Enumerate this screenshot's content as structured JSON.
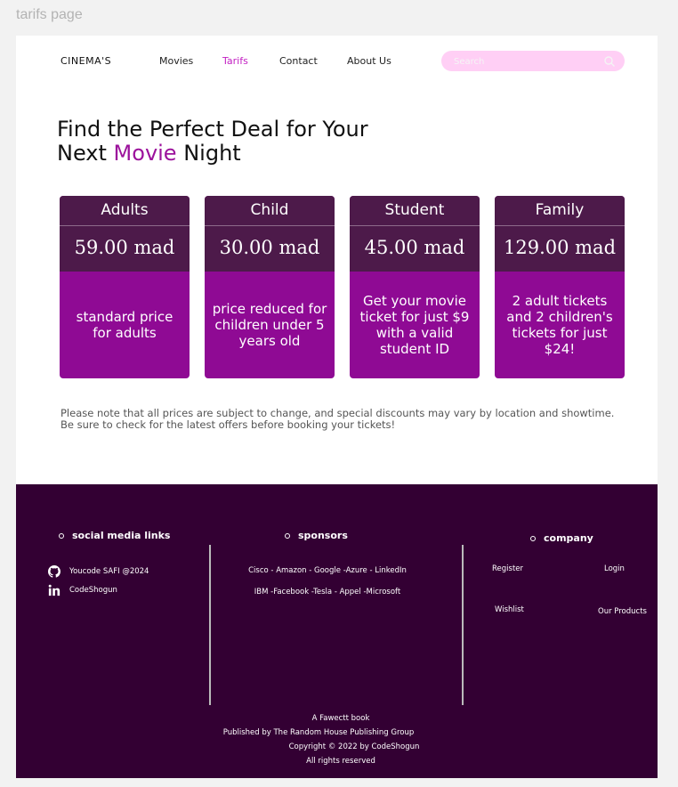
{
  "frame_label": "tarifs page",
  "nav": {
    "brand": "CINEMA'S",
    "links": [
      {
        "label": "Movies",
        "active": false
      },
      {
        "label": "Tarifs",
        "active": true
      },
      {
        "label": "Contact",
        "active": false
      },
      {
        "label": "About Us",
        "active": false
      }
    ],
    "search_placeholder": "Search"
  },
  "hero": {
    "line1": "Find the Perfect Deal for Your",
    "line2_before": "Next ",
    "line2_accent": "Movie",
    "line2_after": " Night"
  },
  "pricing_cards": [
    {
      "title": "Adults",
      "price": "59.00 mad",
      "description": "standard price for adults"
    },
    {
      "title": "Child",
      "price": "30.00 mad",
      "description": "price reduced for children under 5 years old"
    },
    {
      "title": "Student",
      "price": "45.00 mad",
      "description": "Get your movie ticket for just $9 with a valid student ID"
    },
    {
      "title": "Family",
      "price": "129.00 mad",
      "description": "2 adult tickets and 2 children's tickets for just $24!"
    }
  ],
  "note": "Please note that all prices are subject to change, and special discounts may vary by location and showtime. Be sure to check for the latest offers before booking your tickets!",
  "footer": {
    "social": {
      "heading": "social media links",
      "items": [
        {
          "icon": "github-icon",
          "label": "Youcode SAFI @2024"
        },
        {
          "icon": "linkedin-icon",
          "label": "CodeShogun"
        }
      ]
    },
    "sponsors": {
      "heading": "sponsors",
      "lines": [
        "Cisco - Amazon - Google -Azure - LinkedIn",
        "IBM -Facebook -Tesla - Appel -Microsoft"
      ]
    },
    "company": {
      "heading": "company",
      "links": [
        "Register",
        "Login",
        "Wishlist",
        "Our Products"
      ]
    },
    "credits": [
      "A Fawectt book",
      "Published by The Random House Publishing Group",
      "Copyright © 2022 by CodeShogun",
      "All rights reserved"
    ]
  },
  "colors": {
    "accent": "#c21fc2",
    "card_header": "#4d1a4a",
    "card_body": "#8f0a94",
    "footer_bg": "#330033",
    "search_bg": "#ffcff5"
  }
}
